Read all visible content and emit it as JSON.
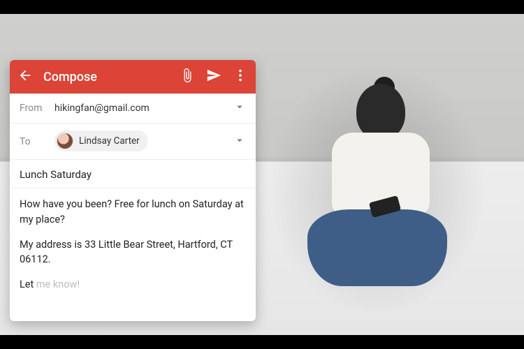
{
  "colors": {
    "accent": "#db4437"
  },
  "appbar": {
    "title": "Compose"
  },
  "from": {
    "label": "From",
    "value": "hikingfan@gmail.com"
  },
  "to": {
    "label": "To",
    "recipient_name": "Lindsay Carter"
  },
  "subject": "Lunch Saturday",
  "body": {
    "p1": "How have you been? Free for lunch on Saturday at my place?",
    "p2": "My address is 33 Little Bear Street, Hartford, CT 06112.",
    "p3_typed": "Let ",
    "p3_suggestion": "me know!"
  }
}
